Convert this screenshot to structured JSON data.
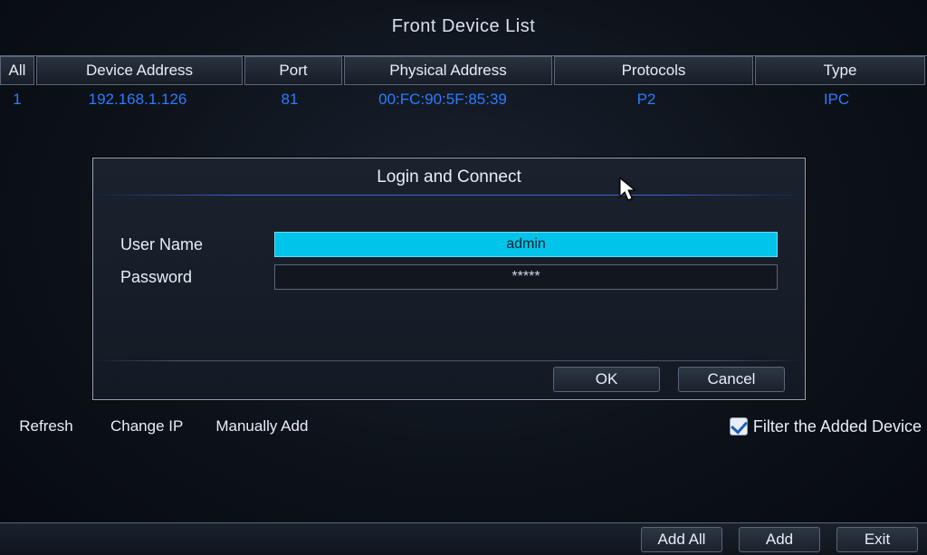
{
  "window": {
    "title": "Front Device List"
  },
  "table": {
    "headers": {
      "index": "All",
      "device_address": "Device Address",
      "port": "Port",
      "physical_address": "Physical Address",
      "protocols": "Protocols",
      "type": "Type"
    },
    "rows": [
      {
        "index": "1",
        "device_address": "192.168.1.126",
        "port": "81",
        "physical_address": "00:FC:90:5F:85:39",
        "protocols": "P2",
        "type": "IPC"
      }
    ]
  },
  "actions": {
    "refresh": "Refresh",
    "change_ip": "Change IP",
    "manually_add": "Manually Add",
    "filter_label": "Filter the Added Device"
  },
  "bottom": {
    "add_all": "Add All",
    "add": "Add",
    "exit": "Exit"
  },
  "modal": {
    "title": "Login and Connect",
    "username_label": "User Name",
    "password_label": "Password",
    "username_value": "admin",
    "password_value": "*****",
    "ok_label": "OK",
    "cancel_label": "Cancel"
  }
}
